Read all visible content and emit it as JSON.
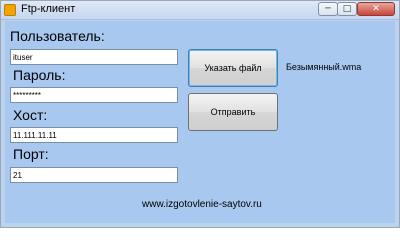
{
  "window": {
    "title": "Ftp-клиент",
    "controls": {
      "minimize": "─",
      "maximize": "□",
      "close": "✕"
    }
  },
  "form": {
    "user_label": "Пользователь:",
    "user_value": "ituser",
    "password_label": "Пароль:",
    "password_value": "*********",
    "host_label": "Хост:",
    "host_value": "11.111.11.11",
    "port_label": "Порт:",
    "port_value": "21"
  },
  "actions": {
    "choose_file_label": "Указать файл",
    "send_label": "Отправить",
    "selected_file": "Безымянный.wma"
  },
  "footer": {
    "website": "www.izgotovlenie-saytov.ru"
  },
  "colors": {
    "client_background": "#a8c8ef",
    "title_background": "#c6d7ee",
    "close_button": "#c9463a",
    "app_icon": "#f2a400"
  }
}
